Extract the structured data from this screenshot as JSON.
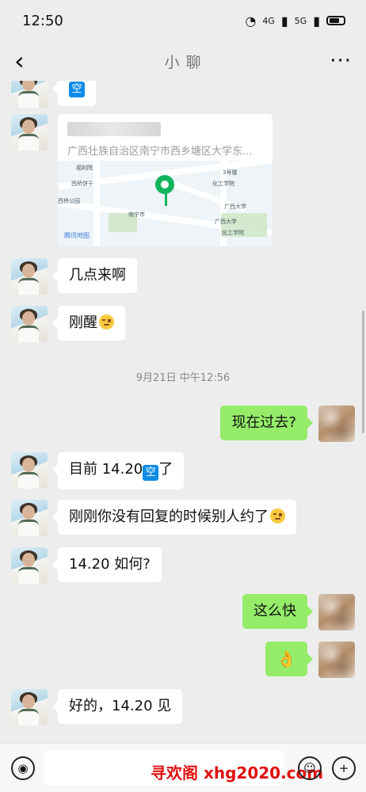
{
  "status": {
    "time": "12:50",
    "network1": "4G",
    "network2": "5G"
  },
  "header": {
    "title": "小 聊",
    "more": "···"
  },
  "messages": [
    {
      "text": "空"
    },
    {
      "address": "广西壮族自治区南宁市西乡塘区大学东...",
      "map_logo": "腾讯地图"
    },
    {
      "text": "几点来啊"
    },
    {
      "text": "刚醒"
    },
    {
      "text": "9月21日 中午12:56"
    },
    {
      "text": "现在过去?"
    },
    {
      "text_prefix": "目前 14.20",
      "text_suffix": "了"
    },
    {
      "text": "刚刚你没有回复的时候别人约了"
    },
    {
      "text": "14.20 如何?"
    },
    {
      "text": "这么快"
    },
    {
      "text": "👌"
    },
    {
      "text": "好的，14.20 见"
    }
  ],
  "map_labels": [
    "福利院",
    "3号楼",
    "西桥饼干",
    "化工学院",
    "西桥公园",
    "广西大学",
    "南宁市",
    "广西大学",
    "化工学院"
  ],
  "bottom": {
    "watermark": "寻欢阁 xhg2020.com"
  }
}
